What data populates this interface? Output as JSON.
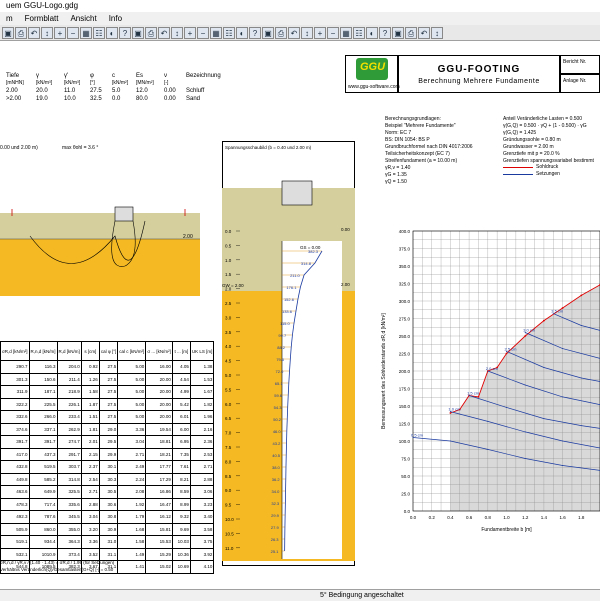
{
  "window": {
    "title": "uem GGU-Logo.gdg"
  },
  "menu": [
    "m",
    "Formblatt",
    "Ansicht",
    "Info"
  ],
  "toolbar_icons": [
    "save-icon",
    "print-icon",
    "undo-icon",
    "arrow-icon",
    "zoom-in-icon",
    "zoom-out-icon",
    "grid-icon",
    "table-icon",
    "color-icon",
    "help-icon"
  ],
  "soil_table": {
    "headers": [
      "Tiefe",
      "γ",
      "γ'",
      "φ",
      "c",
      "Es",
      "ν",
      "Bezeichnung"
    ],
    "units": [
      "[mNHN]",
      "[kN/m³]",
      "[kN/m³]",
      "[°]",
      "[kN/m²]",
      "[MN/m²]",
      "[-]",
      ""
    ],
    "rows": [
      [
        "2.00",
        "20.0",
        "11.0",
        "27.5",
        "5.0",
        "12.0",
        "0.00",
        "Schluff"
      ],
      [
        ">2.00",
        "19.0",
        "10.0",
        "32.5",
        "0.0",
        "80.0",
        "0.00",
        "Sand"
      ]
    ]
  },
  "logo": {
    "text": "GGU",
    "url": "www.ggu-software.com"
  },
  "header": {
    "title": "GGU-FOOTING",
    "subtitle": "Berechnung Mehrere Fundamente",
    "field1": "Bericht Nr.",
    "field2": "Anlage Nr."
  },
  "left_plot": {
    "label": "0.00 und 2.00 m)",
    "angle": "max θohl = 3.6 °",
    "depth": "2.00"
  },
  "stress_plot": {
    "title": "Spannungsschaubild (b = 0.40 und 2.00 m)",
    "top_value": "0.00",
    "mid_value": "2.00",
    "gw_label": "GW = 2.00",
    "gs_label": "GS = 0.00",
    "axis": [
      "0.0",
      "0.5",
      "1.0",
      "1.5",
      "2.0",
      "2.5",
      "3.0",
      "3.5",
      "4.0",
      "4.5",
      "5.0",
      "5.5",
      "6.0",
      "6.5",
      "7.0",
      "7.5",
      "8.0",
      "8.5",
      "9.0",
      "9.5",
      "10.0",
      "10.5",
      "11.0",
      "11.5"
    ],
    "values": [
      "382.3",
      "314.8",
      "211.0",
      "176.1",
      "152.6",
      "133.6",
      "115.0",
      "99.7",
      "88.2",
      "79.6",
      "72.0",
      "65.1",
      "59.6",
      "54.3",
      "50.2",
      "46.0",
      "43.2",
      "40.5",
      "38.0",
      "36.2",
      "34.0",
      "32.3",
      "29.9",
      "27.9",
      "26.3",
      "25.1"
    ]
  },
  "params": {
    "left": [
      "Berechnungsgrundlagen:",
      "Beispiel \"Mehrere Fundamente\"",
      "Norm:  EC 7",
      "BS: DIN 1054: BS P",
      "Grundbruchformel nach DIN 4017:2006",
      "Teilsicherheitskonzept (EC 7)",
      "Streifenfundament (a = 10.00 m)",
      "γR,v = 1.40",
      "γG = 1.35",
      "γQ = 1.50"
    ],
    "right": [
      "Anteil Veränderliche Lasten = 0.500",
      "γ(G,Q) = 0.500 · γQ + (1 - 0.500) · γG",
      "γ(G,Q) = 1.425",
      "Gründungssohle = 0.80 m",
      "Grundwasser = 2.00 m",
      "Grenztiefe mit p = 20.0 %",
      "Grenztiefen spannungsvariabel bestimmt"
    ],
    "legend": [
      "Sohldruck",
      "Setzungen"
    ]
  },
  "chart_data": {
    "type": "line",
    "xlabel": "Fundamentbreite b [m]",
    "ylabel": "Bemessungswert des Sohlwiderstands σR,d [kN/m²]",
    "xlim": [
      0.0,
      2.0
    ],
    "ylim": [
      0.0,
      400.0
    ],
    "xticks": [
      "0.0",
      "0.2",
      "0.4",
      "0.6",
      "0.8",
      "1.0",
      "1.2",
      "1.4",
      "1.6",
      "1.8"
    ],
    "yticks": [
      "0.0",
      "25.0",
      "50.0",
      "75.0",
      "100.0",
      "125.0",
      "150.0",
      "175.0",
      "200.0",
      "225.0",
      "250.0",
      "275.0",
      "300.0",
      "325.0",
      "350.0",
      "375.0",
      "400.0"
    ],
    "series": [
      {
        "name": "Sohldruck",
        "x": [
          0.4,
          0.5,
          0.6,
          0.7,
          0.8,
          0.9,
          1.0,
          1.2,
          1.4,
          1.6,
          1.8,
          2.0
        ],
        "values": [
          140,
          145,
          165,
          163,
          200,
          205,
          225,
          250,
          272,
          290,
          308,
          323
        ]
      },
      {
        "name": "0.5 cm",
        "x": [
          0.0,
          0.4,
          0.8,
          1.2,
          1.6,
          2.0
        ],
        "values": [
          105,
          100,
          88,
          75,
          65,
          58
        ]
      },
      {
        "name": "1.0 cm",
        "x": [
          0.4,
          0.8,
          1.2,
          1.6,
          2.0
        ],
        "values": [
          142,
          128,
          113,
          100,
          90
        ]
      },
      {
        "name": "1.5 cm",
        "x": [
          0.6,
          1.0,
          1.4,
          1.8,
          2.0
        ],
        "values": [
          165,
          148,
          132,
          122,
          118
        ]
      },
      {
        "name": "2.0 cm",
        "x": [
          0.8,
          1.2,
          1.6,
          2.0
        ],
        "values": [
          200,
          180,
          163,
          152
        ]
      },
      {
        "name": "2.5 cm",
        "x": [
          1.0,
          1.4,
          1.8,
          2.0
        ],
        "values": [
          228,
          205,
          190,
          185
        ]
      },
      {
        "name": "3.0 cm",
        "x": [
          1.2,
          1.6,
          2.0
        ],
        "values": [
          255,
          232,
          218
        ]
      },
      {
        "name": "3.5 cm",
        "x": [
          1.5,
          1.8,
          2.0
        ],
        "values": [
          282,
          265,
          258
        ]
      }
    ],
    "grid": true
  },
  "results_table": {
    "headers": [
      "σR,d [kN/m²]",
      "R,n,d [kN/m]",
      "R,d [kN/m]",
      "s [cm]",
      "cal φ [°]",
      "cal c [kN/m²]",
      "σ ... [kN/m²]",
      "t ... [m]",
      "UK LS [m]"
    ],
    "rows": [
      [
        "290.7",
        "116.3",
        "204.0",
        "0.92",
        "27.5",
        "5.00",
        "16.00",
        "4.05",
        "1.38"
      ],
      [
        "301.3",
        "150.6",
        "211.4",
        "1.26",
        "27.5",
        "5.00",
        "20.00",
        "4.54",
        "1.53"
      ],
      [
        "311.9",
        "187.1",
        "218.9",
        "1.58",
        "27.5",
        "5.00",
        "20.00",
        "4.99",
        "1.67"
      ],
      [
        "322.2",
        "225.5",
        "226.1",
        "1.87",
        "27.5",
        "5.00",
        "20.00",
        "5.42",
        "1.82"
      ],
      [
        "332.6",
        "266.0",
        "233.4",
        "1.51",
        "27.5",
        "5.00",
        "20.00",
        "6.01",
        "1.96"
      ],
      [
        "374.6",
        "337.1",
        "262.9",
        "1.81",
        "29.0",
        "3.36",
        "19.54",
        "6.00",
        "2.16"
      ],
      [
        "391.7",
        "391.7",
        "274.7",
        "2.01",
        "29.5",
        "3.04",
        "18.81",
        "6.95",
        "2.36"
      ],
      [
        "417.0",
        "437.3",
        "291.7",
        "2.15",
        "29.9",
        "2.71",
        "18.21",
        "7.35",
        "2.53"
      ],
      [
        "432.8",
        "519.5",
        "303.7",
        "2.37",
        "30.1",
        "2.49",
        "17.77",
        "7.61",
        "2.71"
      ],
      [
        "449.8",
        "585.2",
        "314.8",
        "2.54",
        "30.3",
        "2.24",
        "17.29",
        "8.21",
        "2.88"
      ],
      [
        "463.6",
        "649.9",
        "325.5",
        "2.71",
        "30.5",
        "2.08",
        "16.86",
        "8.59",
        "3.06"
      ],
      [
        "478.3",
        "717.4",
        "335.6",
        "2.88",
        "30.6",
        "1.92",
        "16.47",
        "8.99",
        "3.23"
      ],
      [
        "492.3",
        "787.6",
        "345.5",
        "3.04",
        "30.8",
        "1.79",
        "16.12",
        "9.32",
        "3.40"
      ],
      [
        "505.9",
        "860.0",
        "355.0",
        "3.20",
        "30.9",
        "1.68",
        "15.81",
        "9.69",
        "3.58"
      ],
      [
        "519.1",
        "934.4",
        "364.3",
        "3.36",
        "31.0",
        "1.58",
        "15.53",
        "10.03",
        "3.75"
      ],
      [
        "532.1",
        "1010.9",
        "373.4",
        "3.52",
        "31.1",
        "1.49",
        "15.29",
        "10.36",
        "3.92"
      ],
      [
        "544.8",
        "1089.5",
        "382.3",
        "3.67",
        "31.1",
        "1.41",
        "15.02",
        "10.69",
        "4.10"
      ]
    ],
    "footnote1": "σR,n,d / γR,v / (1.40 · 1.43) = σR,d / 1.99 (für Setzungen)",
    "footnote2": "Verhältnis Veränderlich(Q)/Gesamtlasten(G+Q) [-] = 0.50"
  },
  "status": "5° Bedingung angeschaltet"
}
